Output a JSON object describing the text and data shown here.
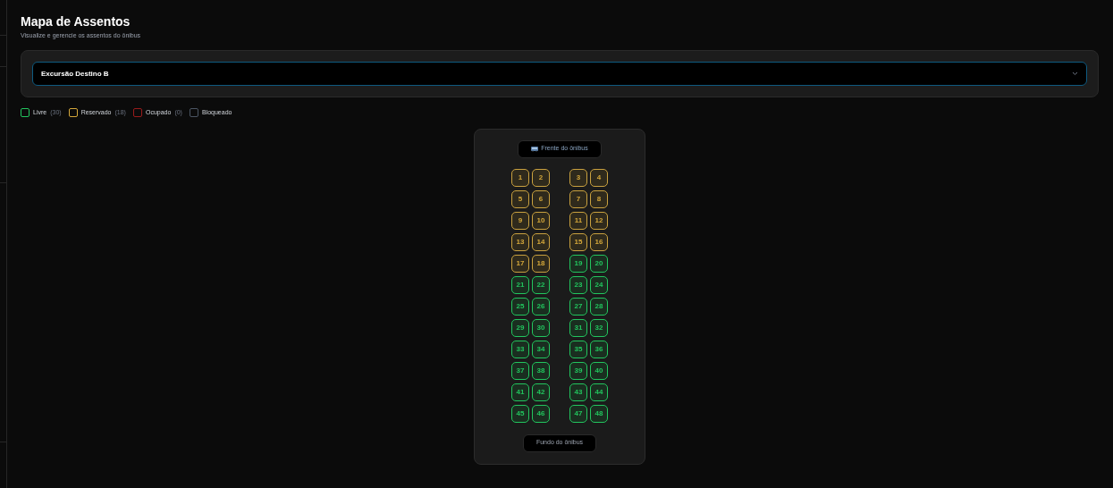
{
  "header": {
    "title": "Mapa de Assentos",
    "subtitle": "Visualize e gerencie os assentos do ônibus"
  },
  "trip_select": {
    "value": "Excursão Destino B"
  },
  "legend": [
    {
      "label": "Livre",
      "count": "(30)",
      "color": "#22c55e"
    },
    {
      "label": "Reservado",
      "count": "(18)",
      "color": "#d4a73a"
    },
    {
      "label": "Ocupado",
      "count": "(0)",
      "color": "#991b1b"
    },
    {
      "label": "Bloqueado",
      "color": "#4b5563"
    }
  ],
  "bus": {
    "front_label": "Frente do ônibus",
    "back_label": "Fundo do ônibus",
    "seats": [
      {
        "number": "1",
        "kind": "reserved"
      },
      {
        "number": "2",
        "kind": "reserved"
      },
      {
        "number": "3",
        "kind": "reserved"
      },
      {
        "number": "4",
        "kind": "reserved"
      },
      {
        "number": "5",
        "kind": "reserved"
      },
      {
        "number": "6",
        "kind": "reserved"
      },
      {
        "number": "7",
        "kind": "reserved"
      },
      {
        "number": "8",
        "kind": "reserved"
      },
      {
        "number": "9",
        "kind": "reserved"
      },
      {
        "number": "10",
        "kind": "reserved"
      },
      {
        "number": "11",
        "kind": "reserved"
      },
      {
        "number": "12",
        "kind": "reserved"
      },
      {
        "number": "13",
        "kind": "reserved"
      },
      {
        "number": "14",
        "kind": "reserved"
      },
      {
        "number": "15",
        "kind": "reserved"
      },
      {
        "number": "16",
        "kind": "reserved"
      },
      {
        "number": "17",
        "kind": "reserved"
      },
      {
        "number": "18",
        "kind": "reserved"
      },
      {
        "number": "19",
        "kind": "free"
      },
      {
        "number": "20",
        "kind": "free"
      },
      {
        "number": "21",
        "kind": "free"
      },
      {
        "number": "22",
        "kind": "free"
      },
      {
        "number": "23",
        "kind": "free"
      },
      {
        "number": "24",
        "kind": "free"
      },
      {
        "number": "25",
        "kind": "free"
      },
      {
        "number": "26",
        "kind": "free"
      },
      {
        "number": "27",
        "kind": "free"
      },
      {
        "number": "28",
        "kind": "free"
      },
      {
        "number": "29",
        "kind": "free"
      },
      {
        "number": "30",
        "kind": "free"
      },
      {
        "number": "31",
        "kind": "free"
      },
      {
        "number": "32",
        "kind": "free"
      },
      {
        "number": "33",
        "kind": "free"
      },
      {
        "number": "34",
        "kind": "free"
      },
      {
        "number": "35",
        "kind": "free"
      },
      {
        "number": "36",
        "kind": "free"
      },
      {
        "number": "37",
        "kind": "free"
      },
      {
        "number": "38",
        "kind": "free"
      },
      {
        "number": "39",
        "kind": "free"
      },
      {
        "number": "40",
        "kind": "free"
      },
      {
        "number": "41",
        "kind": "free"
      },
      {
        "number": "42",
        "kind": "free"
      },
      {
        "number": "43",
        "kind": "free"
      },
      {
        "number": "44",
        "kind": "free"
      },
      {
        "number": "45",
        "kind": "free"
      },
      {
        "number": "46",
        "kind": "free"
      },
      {
        "number": "47",
        "kind": "free"
      },
      {
        "number": "48",
        "kind": "free"
      }
    ]
  }
}
